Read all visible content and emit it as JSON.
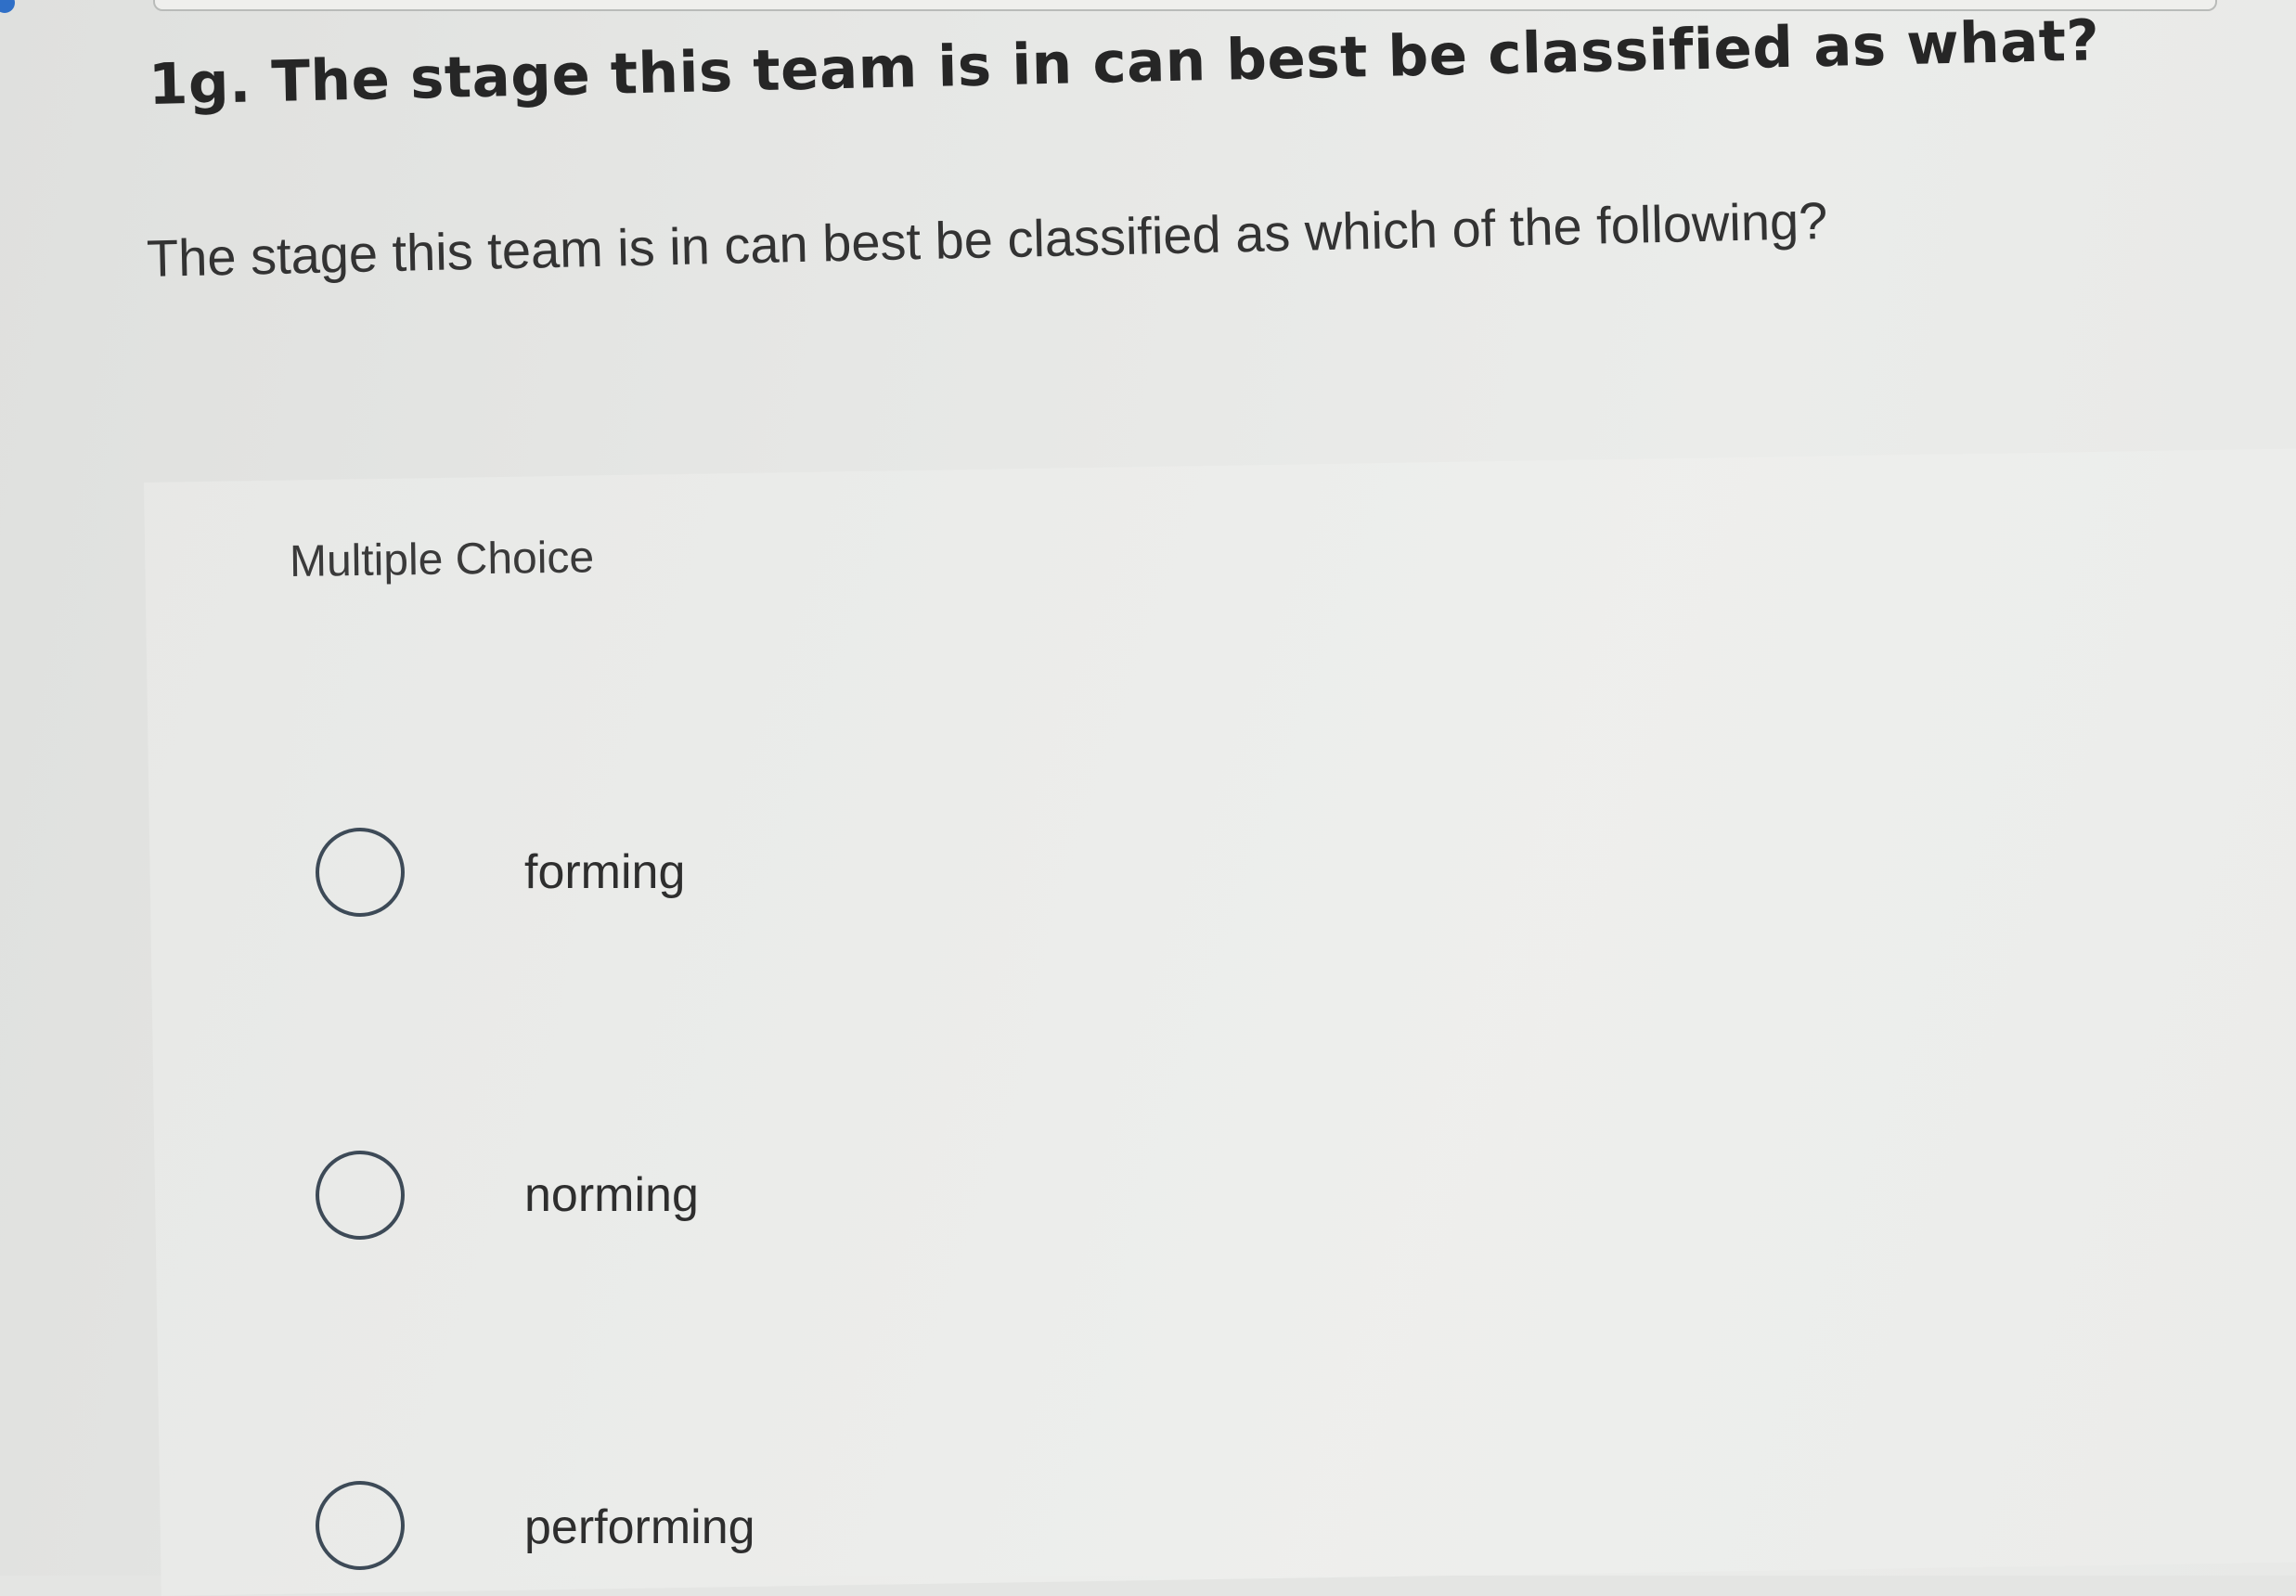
{
  "question": {
    "title": "1g. The stage this team is in can best be classified as what?",
    "prompt": "The stage this team is in can best be classified as which of the following?"
  },
  "choices": {
    "type_label": "Multiple Choice",
    "options": [
      {
        "label": "forming"
      },
      {
        "label": "norming"
      },
      {
        "label": "performing"
      }
    ]
  },
  "colors": {
    "radio_border": "#3d4a57",
    "text": "#2b2b2b"
  }
}
